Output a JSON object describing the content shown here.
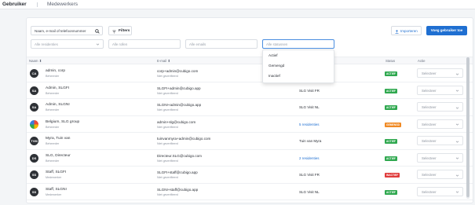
{
  "nav": {
    "tabs": [
      "Gebruiker",
      "Medewerkers"
    ]
  },
  "toolbar": {
    "search_placeholder": "Naam, e-mail of telefoonnummer",
    "filters_label": "Filters",
    "import_label": "Importeren",
    "add_label": "Voeg gebruiker toe"
  },
  "filters": {
    "residences_placeholder": "Alle residenties",
    "roles_placeholder": "Alle rollen",
    "emails_placeholder": "Alle emails",
    "statuses_placeholder": "Alle statussen"
  },
  "status_dropdown": {
    "options": [
      "Actief",
      "Gemengd",
      "Inactief"
    ]
  },
  "table": {
    "columns": [
      "Naam ⬍",
      "E-mail ⬍",
      "Status",
      "Actie"
    ],
    "rows": [
      {
        "initials": "CA",
        "name": "admin, corp",
        "role": "Beheerder",
        "email": "corp+admin@cubigo.com",
        "email_status": "Niet geverifieerd",
        "org": "",
        "status": "ACTIEF",
        "action_placeholder": "Selecteer"
      },
      {
        "initials": "SA",
        "name": "Admin, SLGFI",
        "role": "Beheerder",
        "email": "SLGFI+admin@cubigo.app",
        "email_status": "Niet geverifieerd",
        "org": "SLG Visit FR",
        "status": "ACTIEF",
        "action_placeholder": "Selecteer"
      },
      {
        "initials": "SA",
        "name": "Admin, SLGNI",
        "role": "Beheerder",
        "email": "SLGNI+admin@cubigo.app",
        "email_status": "Niet geverifieerd",
        "org": "SLG Visit NL",
        "status": "ACTIEF",
        "action_placeholder": "Selecteer"
      },
      {
        "initials": "",
        "name": "Belgium, SLG group",
        "role": "Beheerder",
        "email": "admin+slg@cubigo.com",
        "email_status": "Niet geverifieerd",
        "org": "5 residenties",
        "status": "GEMENGD",
        "action_placeholder": "Selecteer"
      },
      {
        "initials": "TVM",
        "name": "Myra, Tuin van",
        "role": "Beheerder",
        "email": "tuinvanmyra+admin@cubigo.com",
        "email_status": "Niet geverifieerd",
        "org": "Tuin van Myra",
        "status": "ACTIEF",
        "action_placeholder": "Selecteer"
      },
      {
        "initials": "DS",
        "name": "SLG, Directeur",
        "role": "Beheerder",
        "email": "Directeur.SLG@cubigo.com",
        "email_status": "Niet geverifieerd",
        "org": "2 residenties",
        "status": "ACTIEF",
        "action_placeholder": "Selecteer"
      },
      {
        "initials": "SS",
        "name": "Staff, SLGFI",
        "role": "Medewerker",
        "email": "SLGFI+staff@cubigo.app",
        "email_status": "Niet geverifieerd",
        "org": "SLG Visit FR",
        "status": "INACTIEF",
        "action_placeholder": "Selecteer"
      },
      {
        "initials": "SS",
        "name": "Staff, SLGNI",
        "role": "Medewerker",
        "email": "SLGNI+staff@cubigo.app",
        "email_status": "Niet geverifieerd",
        "org": "SLG Visit NL",
        "status": "ACTIEF",
        "action_placeholder": "Selecteer"
      }
    ]
  },
  "colors": {
    "primary": "#1f6fd1",
    "status_actief": "#2fa84f",
    "status_gemengd": "#f08a24",
    "status_inactief": "#e03b3b"
  }
}
